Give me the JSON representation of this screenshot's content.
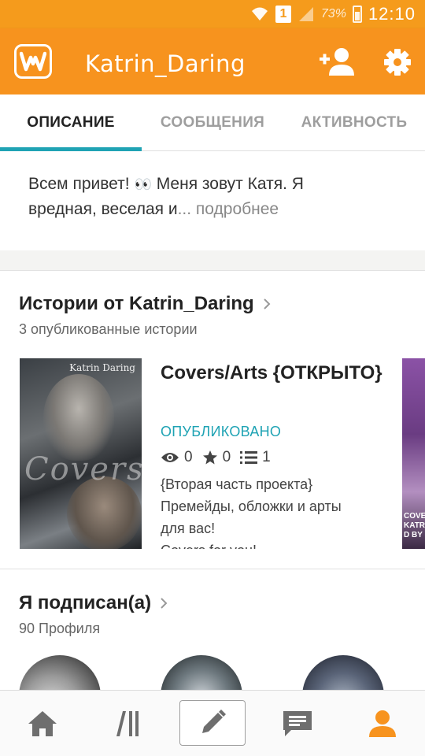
{
  "status_bar": {
    "sim_label": "1",
    "battery": "73%",
    "time": "12:10"
  },
  "app_bar": {
    "title": "Katrin_Daring"
  },
  "tabs": [
    {
      "label": "ОПИСАНИЕ",
      "active": true
    },
    {
      "label": "СООБЩЕНИЯ",
      "active": false
    },
    {
      "label": "АКТИВНОСТЬ",
      "active": false
    }
  ],
  "description": {
    "line1": "Всем привет! ",
    "emoji": "👀",
    "line1_end": " Меня зовут Катя. Я",
    "line2": "вредная, веселая и",
    "more": "... подробнее"
  },
  "stories_section": {
    "title": "Истории от Katrin_Daring",
    "subtitle": "3 опубликованные истории"
  },
  "story": {
    "title": "Covers/Arts {ОТКРЫТО}",
    "status": "ОПУБЛИКОВАНО",
    "views": "0",
    "votes": "0",
    "parts": "1",
    "description_lines": [
      "{Вторая часть проекта}",
      "Премейды, обложки и арты",
      "для вас!",
      "Covers for you!"
    ],
    "cover_text": "Covers",
    "cover_name": "Katrin Daring"
  },
  "story_2": {
    "cover_text": "COVE KATRIN D BY"
  },
  "following_section": {
    "title": "Я подписан(а)",
    "subtitle": "90 Профиля"
  },
  "bottom_nav": [
    "home",
    "library",
    "write",
    "messages",
    "profile"
  ],
  "colors": {
    "brand_orange": "#f7931e",
    "accent_teal": "#1fa3b4"
  }
}
